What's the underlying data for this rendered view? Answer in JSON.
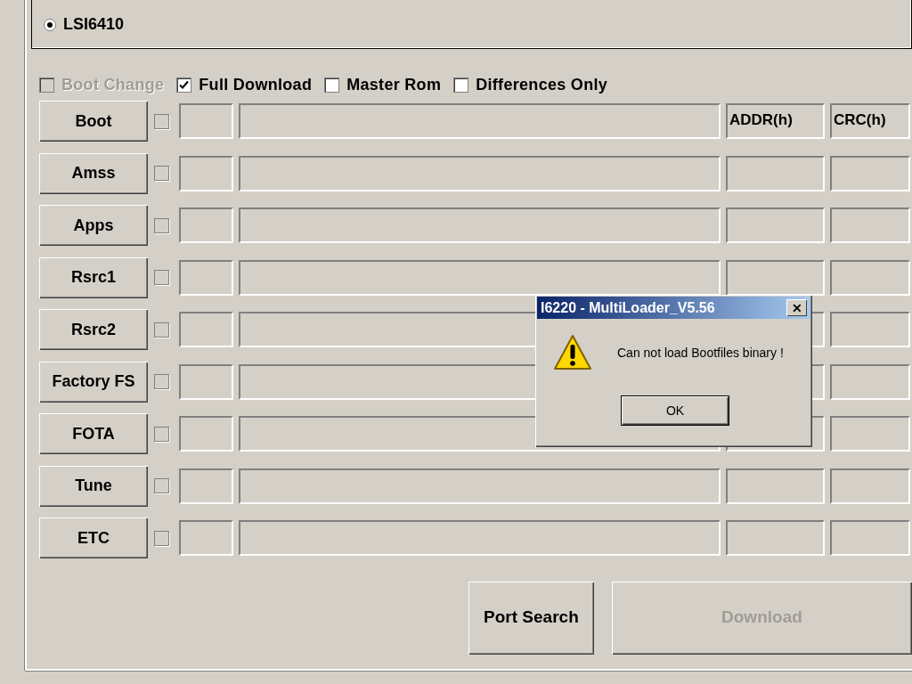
{
  "chip_options": [
    {
      "label": "LSI6410",
      "selected": true
    }
  ],
  "options": [
    {
      "label": "Boot Change",
      "checked": false,
      "disabled": true
    },
    {
      "label": "Full Download",
      "checked": true,
      "disabled": false
    },
    {
      "label": "Master Rom",
      "checked": false,
      "disabled": false
    },
    {
      "label": "Differences Only",
      "checked": false,
      "disabled": false
    }
  ],
  "file_rows": [
    {
      "button": "Boot",
      "checked": false,
      "addr": "ADDR(h)",
      "crc": "CRC(h)"
    },
    {
      "button": "Amss",
      "checked": false
    },
    {
      "button": "Apps",
      "checked": false
    },
    {
      "button": "Rsrc1",
      "checked": false
    },
    {
      "button": "Rsrc2",
      "checked": false
    },
    {
      "button": "Factory FS",
      "checked": false
    },
    {
      "button": "FOTA",
      "checked": false
    },
    {
      "button": "Tune",
      "checked": false
    },
    {
      "button": "ETC",
      "checked": false
    }
  ],
  "actions": [
    {
      "label": "Port Search",
      "disabled": false
    },
    {
      "label": "Download",
      "disabled": true
    }
  ],
  "dialog": {
    "title": "I6220 - MultiLoader_V5.56",
    "close": "✕",
    "message": "Can not load Bootfiles binary !",
    "button": "OK"
  }
}
